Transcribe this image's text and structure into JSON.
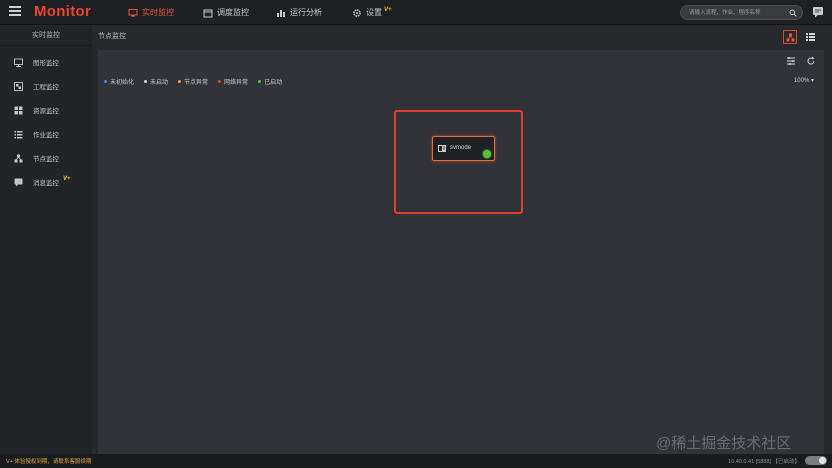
{
  "header": {
    "logo": "Monitor",
    "nav": [
      {
        "label": "实时监控",
        "icon": "monitor-icon",
        "active": true
      },
      {
        "label": "调度监控",
        "icon": "calendar-icon",
        "active": false
      },
      {
        "label": "运行分析",
        "icon": "chart-icon",
        "active": false
      },
      {
        "label": "设置",
        "icon": "gear-icon",
        "active": false,
        "badge": "V+"
      }
    ],
    "search_placeholder": "请输入流程、作业、程序名称",
    "accent": "#e8553c"
  },
  "sidebar": {
    "title": "实时监控",
    "items": [
      {
        "label": "图形监控",
        "icon": "screen-icon"
      },
      {
        "label": "工程监控",
        "icon": "project-icon"
      },
      {
        "label": "资源监控",
        "icon": "resource-icon"
      },
      {
        "label": "作业监控",
        "icon": "list-icon"
      },
      {
        "label": "节点监控",
        "icon": "nodes-icon"
      },
      {
        "label": "消息监控",
        "icon": "message-icon",
        "badge": "V+"
      }
    ]
  },
  "content": {
    "breadcrumb": "节点监控",
    "legend": [
      {
        "label": "未初始化",
        "color": "#3a8ee6"
      },
      {
        "label": "未启动",
        "color": "#d0d2d6"
      },
      {
        "label": "节点异常",
        "color": "#f0a020"
      },
      {
        "label": "网络异常",
        "color": "#e0402a"
      },
      {
        "label": "已启动",
        "color": "#5bc236"
      }
    ],
    "zoom": "100%",
    "node": {
      "name": "svmode",
      "status_color": "#5bc236"
    }
  },
  "watermark": "@稀土掘金技术社区",
  "footer": {
    "notice": "V+ 体验授权到期，请联系客服续期",
    "server": "10.40.0.41:[5888] 【已启动】"
  }
}
